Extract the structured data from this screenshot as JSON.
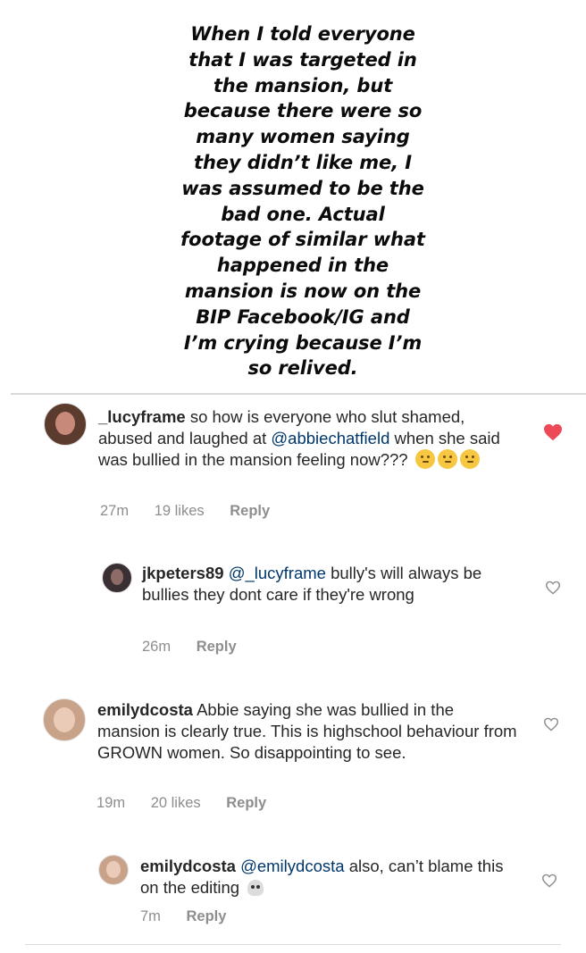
{
  "story": {
    "text": "When I told everyone\nthat I was targeted in\nthe mansion, but\nbecause there were so\nmany women saying\nthey didn’t like me, I\nwas assumed to be the\nbad one. Actual\nfootage of similar what\nhappened in the\nmansion is now on the\nBIP Facebook/IG and\nI’m crying because I’m\nso relived."
  },
  "comments": [
    {
      "username": "_lucyframe",
      "text_a": "so how is everyone who slut shamed, abused and laughed at",
      "mention": "@abbiechatfield",
      "text_b": "when she said was bullied in the mansion feeling now???",
      "time": "27m",
      "likes": "19 likes",
      "reply": "Reply",
      "liked": true,
      "avatar_colors": [
        "#5a3b2e",
        "#c7897a"
      ]
    },
    {
      "username": "jkpeters89",
      "mention": "@_lucyframe",
      "text": "bully's will always be bullies they dont care if they're wrong",
      "time": "26m",
      "reply": "Reply",
      "liked": false,
      "avatar_colors": [
        "#3a2f33",
        "#8d6b66"
      ]
    },
    {
      "username": "emilydcosta",
      "text": "Abbie saying she was bullied in the mansion is clearly true. This is highschool behaviour from GROWN women. So disappointing to see.",
      "time": "19m",
      "likes": "20 likes",
      "reply": "Reply",
      "liked": false,
      "avatar_colors": [
        "#c9a28a",
        "#e9cbb7"
      ]
    },
    {
      "username": "emilydcosta",
      "mention": "@emilydcosta",
      "text": "also, can’t blame this on the editing",
      "time": "7m",
      "reply": "Reply",
      "liked": false,
      "avatar_colors": [
        "#c9a28a",
        "#e9cbb7"
      ]
    }
  ],
  "colors": {
    "heart_liked": "#ed4956",
    "heart_outline": "#8e8e8e",
    "mention": "#00376b",
    "meta": "#8e8e8e"
  },
  "icons": {
    "liked": "filled-heart-icon",
    "unliked": "heart-outline-icon",
    "thinking_emoji": "thinking-face-emoji",
    "skull_emoji": "skull-emoji"
  }
}
